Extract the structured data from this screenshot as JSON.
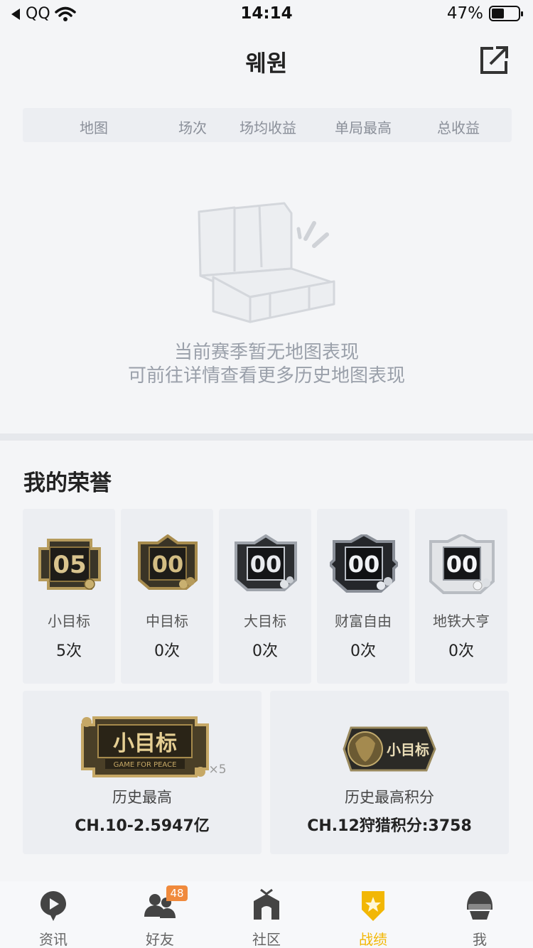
{
  "status_bar": {
    "carrier": "QQ",
    "time": "14:14",
    "battery_percent": "47%",
    "battery_level": 0.47
  },
  "header": {
    "title": "웨원",
    "share_icon": "share-external-icon"
  },
  "stats_table": {
    "columns": [
      "地图",
      "场次",
      "场均收益",
      "单局最高",
      "总收益"
    ]
  },
  "empty_state": {
    "line1": "当前赛季暂无地图表现",
    "line2": "可前往详情查看更多历史地图表现"
  },
  "honors": {
    "title": "我的荣誉",
    "items": [
      {
        "badge_number": "05",
        "name": "小目标",
        "count": "5次",
        "tier_color": "#b69b5c"
      },
      {
        "badge_number": "00",
        "name": "中目标",
        "count": "0次",
        "tier_color": "#a88c4e"
      },
      {
        "badge_number": "00",
        "name": "大目标",
        "count": "0次",
        "tier_color": "#9ea3ab"
      },
      {
        "badge_number": "00",
        "name": "财富自由",
        "count": "0次",
        "tier_color": "#8a8f98"
      },
      {
        "badge_number": "00",
        "name": "地铁大亨",
        "count": "0次",
        "tier_color": "#b8bcc2"
      }
    ]
  },
  "best": {
    "left": {
      "badge_text": "小目标",
      "badge_subtext": "GAME FOR PEACE",
      "multiplier": "×5",
      "label": "历史最高",
      "value": "CH.10-2.5947亿"
    },
    "right": {
      "badge_text": "小目标",
      "label": "历史最高积分",
      "value": "CH.12狩猎积分:3758"
    }
  },
  "tabbar": {
    "items": [
      {
        "label": "资讯",
        "icon": "news-play-icon"
      },
      {
        "label": "好友",
        "icon": "friends-icon",
        "badge": "48"
      },
      {
        "label": "社区",
        "icon": "community-house-icon"
      },
      {
        "label": "战绩",
        "icon": "record-shield-star-icon",
        "active": true
      },
      {
        "label": "我",
        "icon": "helmet-profile-icon"
      }
    ],
    "active_color": "#f2b705"
  }
}
